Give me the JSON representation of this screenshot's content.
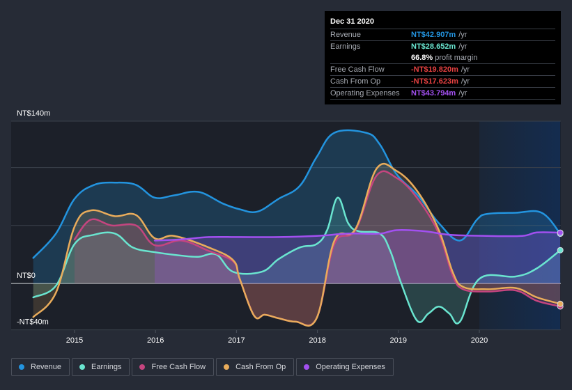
{
  "tooltip": {
    "date": "Dec 31 2020",
    "rows": [
      {
        "label": "Revenue",
        "value": "NT$42.907m",
        "unit": "/yr",
        "color": "#2394df"
      },
      {
        "label": "Earnings",
        "value": "NT$28.652m",
        "unit": "/yr",
        "color": "#6ae5d0"
      },
      {
        "label": "",
        "value": "66.8%",
        "unit": "profit margin",
        "color": "#ffffff"
      },
      {
        "label": "Free Cash Flow",
        "value": "-NT$19.820m",
        "unit": "/yr",
        "color": "#e64141"
      },
      {
        "label": "Cash From Op",
        "value": "-NT$17.623m",
        "unit": "/yr",
        "color": "#e64141"
      },
      {
        "label": "Operating Expenses",
        "value": "NT$43.794m",
        "unit": "/yr",
        "color": "#a250f0"
      }
    ]
  },
  "legend": [
    {
      "label": "Revenue",
      "color": "#2394df"
    },
    {
      "label": "Earnings",
      "color": "#6ae5d0"
    },
    {
      "label": "Free Cash Flow",
      "color": "#c5457f"
    },
    {
      "label": "Cash From Op",
      "color": "#e9ac5b"
    },
    {
      "label": "Operating Expenses",
      "color": "#a250f0"
    }
  ],
  "chart_data": {
    "type": "area",
    "title": "",
    "xlabel": "",
    "ylabel": "",
    "y_tick_labels": [
      {
        "label": "NT$140m",
        "value": 140
      },
      {
        "label": "NT$0",
        "value": 0
      },
      {
        "label": "-NT$40m",
        "value": -40
      }
    ],
    "gridlines": [
      140,
      100,
      50,
      0,
      -40
    ],
    "ylim": [
      -40,
      140
    ],
    "xlim": [
      2014.49,
      2021.0
    ],
    "x_tick_labels": [
      "2015",
      "2016",
      "2017",
      "2018",
      "2019",
      "2020"
    ],
    "x_ticks": [
      2015,
      2016,
      2017,
      2018,
      2019,
      2020
    ],
    "highlight_region": [
      2020.0,
      2021.0
    ],
    "grid": true,
    "legend_position": "bottom-left",
    "series": [
      {
        "name": "Revenue",
        "color": "#2394df",
        "points": [
          [
            2014.49,
            22
          ],
          [
            2014.77,
            43
          ],
          [
            2015.0,
            73
          ],
          [
            2015.24,
            85
          ],
          [
            2015.5,
            87
          ],
          [
            2015.76,
            85
          ],
          [
            2015.99,
            74
          ],
          [
            2016.23,
            76
          ],
          [
            2016.53,
            79
          ],
          [
            2016.83,
            69
          ],
          [
            2017.04,
            64
          ],
          [
            2017.26,
            62
          ],
          [
            2017.52,
            73
          ],
          [
            2017.78,
            84
          ],
          [
            2017.99,
            109
          ],
          [
            2018.21,
            130
          ],
          [
            2018.6,
            130
          ],
          [
            2018.77,
            120
          ],
          [
            2018.98,
            94
          ],
          [
            2019.24,
            76
          ],
          [
            2019.5,
            52
          ],
          [
            2019.76,
            37
          ],
          [
            2019.97,
            55
          ],
          [
            2020.1,
            60
          ],
          [
            2020.45,
            61
          ],
          [
            2020.77,
            61
          ],
          [
            2021.0,
            42.9
          ]
        ]
      },
      {
        "name": "Earnings",
        "color": "#6ae5d0",
        "points": [
          [
            2014.49,
            -12
          ],
          [
            2014.77,
            -2
          ],
          [
            2015.0,
            34
          ],
          [
            2015.24,
            42
          ],
          [
            2015.5,
            43
          ],
          [
            2015.72,
            31
          ],
          [
            2015.99,
            27
          ],
          [
            2016.32,
            24
          ],
          [
            2016.53,
            23
          ],
          [
            2016.75,
            25
          ],
          [
            2016.96,
            10
          ],
          [
            2017.31,
            10
          ],
          [
            2017.52,
            21
          ],
          [
            2017.78,
            31
          ],
          [
            2017.99,
            34
          ],
          [
            2018.12,
            46
          ],
          [
            2018.25,
            74
          ],
          [
            2018.38,
            52
          ],
          [
            2018.51,
            45
          ],
          [
            2018.77,
            43
          ],
          [
            2018.9,
            28
          ],
          [
            2019.03,
            1
          ],
          [
            2019.23,
            -32
          ],
          [
            2019.37,
            -26
          ],
          [
            2019.5,
            -20
          ],
          [
            2019.63,
            -26
          ],
          [
            2019.76,
            -33
          ],
          [
            2020.0,
            4
          ],
          [
            2020.45,
            6
          ],
          [
            2020.71,
            13
          ],
          [
            2021.0,
            28.7
          ]
        ]
      },
      {
        "name": "Free Cash Flow",
        "color": "#c5457f",
        "points": [
          [
            2015.0,
            38
          ],
          [
            2015.2,
            55
          ],
          [
            2015.46,
            50
          ],
          [
            2015.76,
            50
          ],
          [
            2015.99,
            33
          ],
          [
            2016.32,
            37
          ],
          [
            2016.66,
            28
          ],
          [
            2016.96,
            19
          ],
          [
            2017.04,
            4
          ],
          [
            2017.22,
            -28
          ],
          [
            2017.35,
            -27
          ],
          [
            2017.52,
            -30
          ],
          [
            2017.73,
            -33
          ],
          [
            2017.99,
            -30
          ],
          [
            2018.21,
            34
          ],
          [
            2018.47,
            46
          ],
          [
            2018.73,
            93
          ],
          [
            2018.98,
            91
          ],
          [
            2019.24,
            73
          ],
          [
            2019.5,
            43
          ],
          [
            2019.67,
            7
          ],
          [
            2019.8,
            -5
          ],
          [
            2020.1,
            -7
          ],
          [
            2020.45,
            -6
          ],
          [
            2020.71,
            -15
          ],
          [
            2021.0,
            -19.8
          ]
        ]
      },
      {
        "name": "Cash From Op",
        "color": "#e9ac5b",
        "points": [
          [
            2014.49,
            -29
          ],
          [
            2014.77,
            -8
          ],
          [
            2015.0,
            49
          ],
          [
            2015.2,
            63
          ],
          [
            2015.5,
            58
          ],
          [
            2015.76,
            59
          ],
          [
            2015.99,
            39
          ],
          [
            2016.23,
            41
          ],
          [
            2016.66,
            31
          ],
          [
            2016.96,
            20
          ],
          [
            2017.04,
            4
          ],
          [
            2017.22,
            -28
          ],
          [
            2017.35,
            -27
          ],
          [
            2017.52,
            -30
          ],
          [
            2017.73,
            -33
          ],
          [
            2017.99,
            -30
          ],
          [
            2018.21,
            37
          ],
          [
            2018.47,
            47
          ],
          [
            2018.73,
            99
          ],
          [
            2018.98,
            97
          ],
          [
            2019.24,
            79
          ],
          [
            2019.5,
            46
          ],
          [
            2019.67,
            10
          ],
          [
            2019.8,
            -3
          ],
          [
            2020.1,
            -5
          ],
          [
            2020.45,
            -4
          ],
          [
            2020.71,
            -12
          ],
          [
            2021.0,
            -17.6
          ]
        ]
      },
      {
        "name": "Operating Expenses",
        "color": "#a250f0",
        "points": [
          [
            2015.99,
            37
          ],
          [
            2016.32,
            38
          ],
          [
            2016.66,
            40
          ],
          [
            2017.04,
            40
          ],
          [
            2017.52,
            40
          ],
          [
            2017.99,
            41
          ],
          [
            2018.38,
            43
          ],
          [
            2018.77,
            43
          ],
          [
            2018.98,
            46
          ],
          [
            2019.33,
            45
          ],
          [
            2019.63,
            42
          ],
          [
            2020.1,
            41
          ],
          [
            2020.53,
            41
          ],
          [
            2020.71,
            44
          ],
          [
            2021.0,
            43.8
          ]
        ]
      }
    ]
  }
}
